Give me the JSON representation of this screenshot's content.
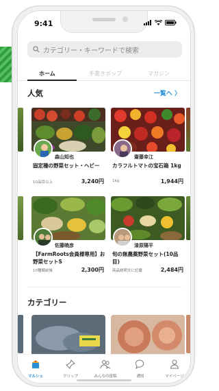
{
  "status": {
    "time": "9:41"
  },
  "search": {
    "placeholder": "カテゴリー・キーワードで検索"
  },
  "tabs": [
    {
      "label": "ホーム"
    },
    {
      "label": "手書きポップ"
    },
    {
      "label": "マガジン"
    }
  ],
  "popular": {
    "title": "人気",
    "see_all": "一覧へ 〉",
    "items": [
      {
        "farmer": "森山知也",
        "title": "固定種の野菜セット・ヘビー",
        "unit": "10品目以上",
        "price": "3,240円"
      },
      {
        "farmer": "齋藤幸江",
        "title": "カラフルトマトの宝石箱 1kg",
        "unit": "1kg",
        "price": "1,944円"
      },
      {
        "farmer": "佐藤暁彦",
        "title": "【FarmRoots会員様専用】お野菜セットS",
        "unit": "10種類前後",
        "price": "2,300円"
      },
      {
        "farmer": "漆原陽平",
        "title": "旬の無農薬野菜セット(10品目)",
        "unit": "商品説明文に記載",
        "price": "2,484円"
      }
    ]
  },
  "category": {
    "title": "カテゴリー"
  },
  "nav": [
    {
      "label": "マルシェ",
      "icon": "marche-icon",
      "active": true
    },
    {
      "label": "クリップ",
      "icon": "pin-icon",
      "active": false
    },
    {
      "label": "みんなの投稿",
      "icon": "people-icon",
      "active": false
    },
    {
      "label": "通知",
      "icon": "chat-bubble-icon",
      "active": false
    },
    {
      "label": "マイページ",
      "icon": "person-icon",
      "active": false
    }
  ],
  "colors": {
    "accent": "#2b8fd6",
    "stripe_green": "#2f9b3f"
  }
}
